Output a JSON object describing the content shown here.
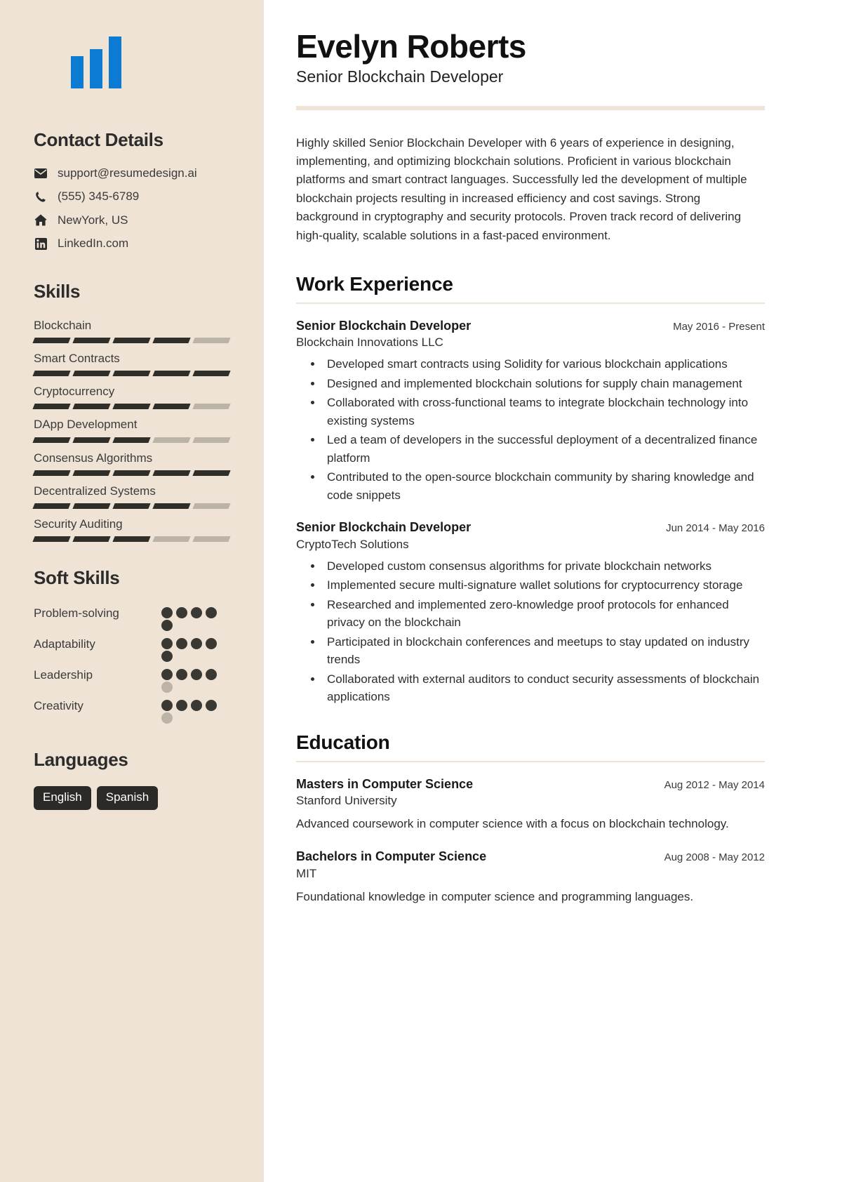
{
  "theme": {
    "sidebar_bg": "#EEE3D4",
    "logo_color": "#0B7BD4",
    "accent_rule": "#EEE3D4",
    "skill_on": "#302E28",
    "skill_off": "#BBB3A6",
    "badge_bg": "#2B2A26",
    "badge_text": "#FFFFFF"
  },
  "sidebar": {
    "logo": {
      "name": "logo-bars-icon",
      "bars": 3
    },
    "contact": {
      "heading": "Contact Details",
      "items": [
        {
          "icon": "envelope-icon",
          "value": "support@resumedesign.ai"
        },
        {
          "icon": "phone-icon",
          "value": "(555) 345-6789"
        },
        {
          "icon": "home-icon",
          "value": "NewYork, US"
        },
        {
          "icon": "linkedin-icon",
          "value": "LinkedIn.com"
        }
      ]
    },
    "skills": {
      "heading": "Skills",
      "segments_total": 5,
      "items": [
        {
          "label": "Blockchain",
          "level": 4
        },
        {
          "label": "Smart Contracts",
          "level": 5
        },
        {
          "label": "Cryptocurrency",
          "level": 4
        },
        {
          "label": "DApp Development",
          "level": 3
        },
        {
          "label": "Consensus Algorithms",
          "level": 5
        },
        {
          "label": "Decentralized Systems",
          "level": 4
        },
        {
          "label": "Security Auditing",
          "level": 3
        }
      ]
    },
    "soft_skills": {
      "heading": "Soft Skills",
      "dots_total": 5,
      "items": [
        {
          "label": "Problem-solving",
          "level": 5
        },
        {
          "label": "Adaptability",
          "level": 5
        },
        {
          "label": "Leadership",
          "level": 4
        },
        {
          "label": "Creativity",
          "level": 4
        }
      ]
    },
    "languages": {
      "heading": "Languages",
      "items": [
        "English",
        "Spanish"
      ]
    }
  },
  "main": {
    "name": "Evelyn Roberts",
    "job_title": "Senior Blockchain Developer",
    "summary": "Highly skilled Senior Blockchain Developer with 6 years of experience in designing, implementing, and optimizing blockchain solutions. Proficient in various blockchain platforms and smart contract languages. Successfully led the development of multiple blockchain projects resulting in increased efficiency and cost savings. Strong background in cryptography and security protocols. Proven track record of delivering high-quality, scalable solutions in a fast-paced environment.",
    "work": {
      "heading": "Work Experience",
      "entries": [
        {
          "role": "Senior Blockchain Developer",
          "date": "May 2016 - Present",
          "org": "Blockchain Innovations LLC",
          "bullets": [
            "Developed smart contracts using Solidity for various blockchain applications",
            "Designed and implemented blockchain solutions for supply chain management",
            "Collaborated with cross-functional teams to integrate blockchain technology into existing systems",
            "Led a team of developers in the successful deployment of a decentralized finance platform",
            "Contributed to the open-source blockchain community by sharing knowledge and code snippets"
          ]
        },
        {
          "role": "Senior Blockchain Developer",
          "date": "Jun 2014 - May 2016",
          "org": "CryptoTech Solutions",
          "bullets": [
            "Developed custom consensus algorithms for private blockchain networks",
            "Implemented secure multi-signature wallet solutions for cryptocurrency storage",
            "Researched and implemented zero-knowledge proof protocols for enhanced privacy on the blockchain",
            "Participated in blockchain conferences and meetups to stay updated on industry trends",
            "Collaborated with external auditors to conduct security assessments of blockchain applications"
          ]
        }
      ]
    },
    "education": {
      "heading": "Education",
      "entries": [
        {
          "degree": "Masters in Computer Science",
          "date": "Aug 2012 - May 2014",
          "school": "Stanford University",
          "description": "Advanced coursework in computer science with a focus on blockchain technology."
        },
        {
          "degree": "Bachelors in Computer Science",
          "date": "Aug 2008 - May 2012",
          "school": "MIT",
          "description": "Foundational knowledge in computer science and programming languages."
        }
      ]
    }
  }
}
